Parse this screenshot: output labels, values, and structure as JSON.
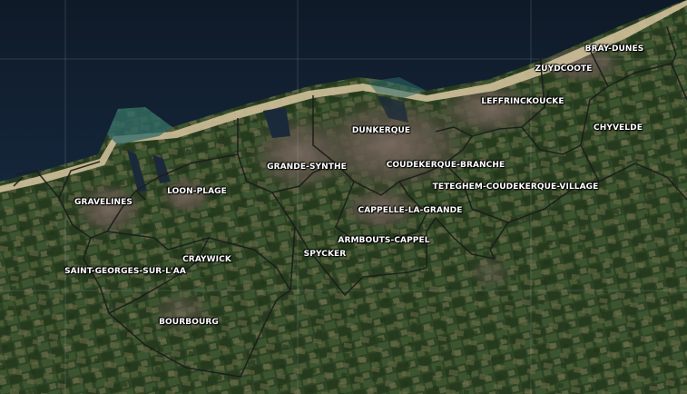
{
  "map": {
    "type": "satellite",
    "colors": {
      "sea": "#101d2c",
      "beach": "#cdbf9a",
      "land": "#2f4424",
      "urban": "#6b5e55",
      "boundary": "#1f1f1f",
      "grid": "#9aa3a8",
      "label": "#ffffff"
    },
    "communes": [
      {
        "id": "bray-dunes",
        "label": "BRAY-DUNES"
      },
      {
        "id": "zuydcoote",
        "label": "ZUYDCOOTE"
      },
      {
        "id": "leffrinckoucke",
        "label": "LEFFRINCKOUCKE"
      },
      {
        "id": "chyvelde",
        "label": "CHYVELDE"
      },
      {
        "id": "dunkerque",
        "label": "DUNKERQUE"
      },
      {
        "id": "grande-synthe",
        "label": "GRANDE-SYNTHE"
      },
      {
        "id": "coudekerque-branche",
        "label": "COUDEKERQUE-BRANCHE"
      },
      {
        "id": "teteghem-coudekerque-village",
        "label": "TETEGHEM-COUDEKERQUE-VILLAGE"
      },
      {
        "id": "cappelle-la-grande",
        "label": "CAPPELLE-LA-GRANDE"
      },
      {
        "id": "armbouts-cappel",
        "label": "ARMBOUTS-CAPPEL"
      },
      {
        "id": "loon-plage",
        "label": "LOON-PLAGE"
      },
      {
        "id": "gravelines",
        "label": "GRAVELINES"
      },
      {
        "id": "craywick",
        "label": "CRAYWICK"
      },
      {
        "id": "spycker",
        "label": "SPYCKER"
      },
      {
        "id": "saint-georges-sur-l-aa",
        "label": "SAINT-GEORGES-SUR-L'AA"
      },
      {
        "id": "bourbourg",
        "label": "BOURBOURG"
      }
    ]
  }
}
